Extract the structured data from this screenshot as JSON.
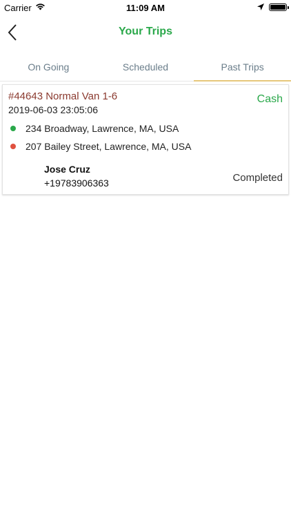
{
  "status_bar": {
    "carrier": "Carrier",
    "time": "11:09 AM",
    "icons": [
      "wifi-icon",
      "location-arrow-icon",
      "battery-icon"
    ]
  },
  "nav": {
    "title": "Your Trips",
    "back_icon": "chevron-left-icon"
  },
  "tabs": [
    {
      "label": "On Going",
      "active": false
    },
    {
      "label": "Scheduled",
      "active": false
    },
    {
      "label": "Past Trips",
      "active": true
    }
  ],
  "trips": [
    {
      "id_label": "#44643 Normal Van 1-6",
      "datetime": "2019-06-03 23:05:06",
      "payment": "Cash",
      "pickup": "234 Broadway, Lawrence, MA, USA",
      "dropoff": "207 Bailey Street, Lawrence, MA, USA",
      "driver_name": "Jose Cruz",
      "driver_phone": "+19783906363",
      "status": "Completed"
    }
  ],
  "colors": {
    "accent_green": "#2aa84a",
    "trip_id": "#8b3a2f",
    "pickup_dot": "#2aa84a",
    "dropoff_dot": "#e0513f",
    "tab_indicator": "#e6c77a",
    "tab_text": "#6a7d8a"
  }
}
